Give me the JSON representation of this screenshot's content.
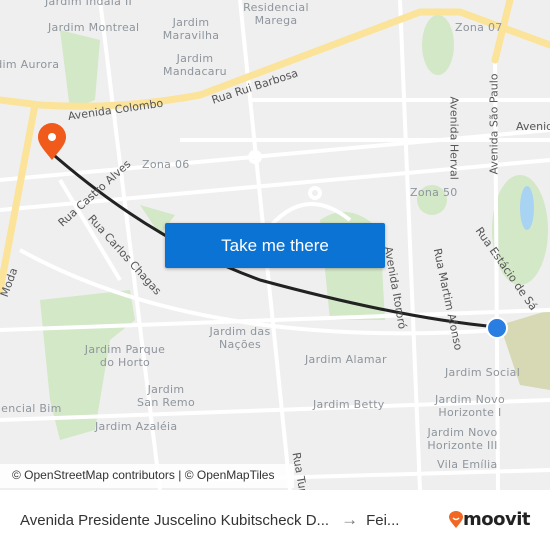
{
  "map": {
    "areas": [
      "Jardim Indaiá II",
      "Jardim Montreal",
      "Jardim Maravilha",
      "Jardim Mandacaru",
      "Residencial Marega",
      "Jardim Aurora",
      "Zona 07",
      "Zona 06",
      "Zona 50",
      "Jardim das Nações",
      "Jardim Parque do Horto",
      "Jardim San Remo",
      "Residencial Bim",
      "Jardim Azaléia",
      "Jardim Alamar",
      "Jardim Betty",
      "Jardim Social",
      "Jardim Novo Horizonte I",
      "Jardim Novo Horizonte III",
      "Vila Emília"
    ],
    "streets": [
      "Avenida Colombo",
      "Rua Rui Barbosa",
      "Rua Castro Alves",
      "Rua Carlos Chagas",
      "Avenida Herval",
      "Avenida São Paulo",
      "Avenida Itororó",
      "Rua Martim Afonso",
      "Rua Estácio de Sá",
      "Avenida",
      "Rua Tupi",
      "Moda",
      "Rua"
    ],
    "colors": {
      "route": "#222222",
      "origin": "#2a7de1",
      "destination": "#f05a1a",
      "main_road": "#fbe39a",
      "park": "#cfe6c3",
      "water": "#a9d3f2"
    }
  },
  "cta": {
    "label": "Take me there"
  },
  "attribution": "© OpenStreetMap contributors | © OpenMapTiles",
  "footer": {
    "origin": "Avenida Presidente Juscelino Kubitscheck D...",
    "arrow": "→",
    "destination": "Fei...",
    "brand": "moovit"
  }
}
